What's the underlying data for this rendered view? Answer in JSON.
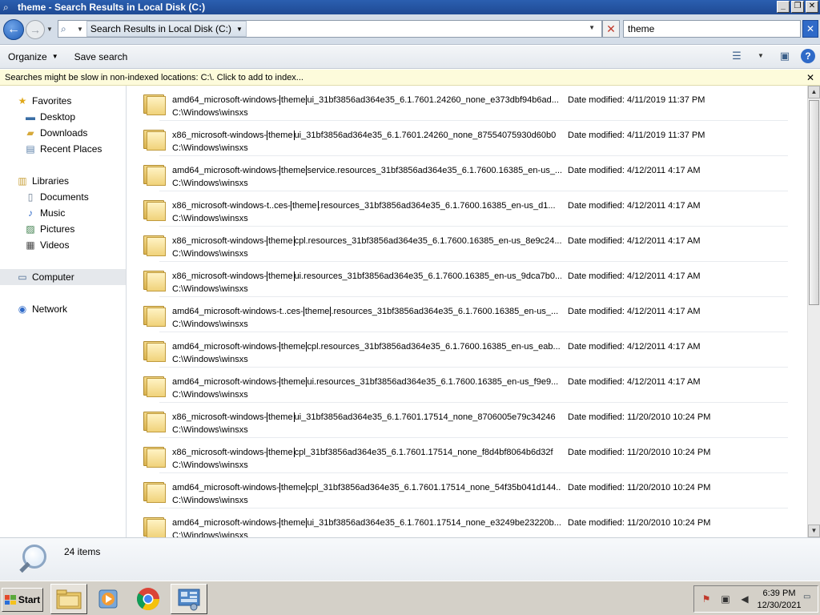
{
  "window": {
    "title": "theme - Search Results in Local Disk (C:)",
    "buttons": {
      "minimize": "_",
      "maximize": "❐",
      "close": "✕"
    }
  },
  "address": {
    "crumb": "Search Results in Local Disk (C:)",
    "search_value": "theme"
  },
  "toolbar": {
    "organize": "Organize",
    "save_search": "Save search"
  },
  "infobar": {
    "message": "Searches might be slow in non-indexed locations: C:\\. Click to add to index...",
    "close": "✕"
  },
  "nav": {
    "favorites": "Favorites",
    "desktop": "Desktop",
    "downloads": "Downloads",
    "recent_places": "Recent Places",
    "libraries": "Libraries",
    "documents": "Documents",
    "music": "Music",
    "pictures": "Pictures",
    "videos": "Videos",
    "computer": "Computer",
    "network": "Network"
  },
  "results": [
    {
      "pre": "amd64_microsoft-windows-",
      "hl": "theme",
      "post": "ui_31bf3856ad364e35_6.1.7601.24260_none_e373dbf94b6ad...",
      "path": "C:\\Windows\\winsxs",
      "date": "Date modified: 4/11/2019 11:37 PM"
    },
    {
      "pre": "x86_microsoft-windows-",
      "hl": "theme",
      "post": "ui_31bf3856ad364e35_6.1.7601.24260_none_87554075930d60b0",
      "path": "C:\\Windows\\winsxs",
      "date": "Date modified: 4/11/2019 11:37 PM"
    },
    {
      "pre": "amd64_microsoft-windows-",
      "hl": "theme",
      "post": "service.resources_31bf3856ad364e35_6.1.7600.16385_en-us_...",
      "path": "C:\\Windows\\winsxs",
      "date": "Date modified: 4/12/2011 4:17 AM"
    },
    {
      "pre": "x86_microsoft-windows-t..ces-",
      "hl": "theme",
      "post": ".resources_31bf3856ad364e35_6.1.7600.16385_en-us_d1...",
      "path": "C:\\Windows\\winsxs",
      "date": "Date modified: 4/12/2011 4:17 AM"
    },
    {
      "pre": "x86_microsoft-windows-",
      "hl": "theme",
      "post": "cpl.resources_31bf3856ad364e35_6.1.7600.16385_en-us_8e9c24...",
      "path": "C:\\Windows\\winsxs",
      "date": "Date modified: 4/12/2011 4:17 AM"
    },
    {
      "pre": "x86_microsoft-windows-",
      "hl": "theme",
      "post": "ui.resources_31bf3856ad364e35_6.1.7600.16385_en-us_9dca7b0...",
      "path": "C:\\Windows\\winsxs",
      "date": "Date modified: 4/12/2011 4:17 AM"
    },
    {
      "pre": "amd64_microsoft-windows-t..ces-",
      "hl": "theme",
      "post": ".resources_31bf3856ad364e35_6.1.7600.16385_en-us_...",
      "path": "C:\\Windows\\winsxs",
      "date": "Date modified: 4/12/2011 4:17 AM"
    },
    {
      "pre": "amd64_microsoft-windows-",
      "hl": "theme",
      "post": "cpl.resources_31bf3856ad364e35_6.1.7600.16385_en-us_eab...",
      "path": "C:\\Windows\\winsxs",
      "date": "Date modified: 4/12/2011 4:17 AM"
    },
    {
      "pre": "amd64_microsoft-windows-",
      "hl": "theme",
      "post": "ui.resources_31bf3856ad364e35_6.1.7600.16385_en-us_f9e9...",
      "path": "C:\\Windows\\winsxs",
      "date": "Date modified: 4/12/2011 4:17 AM"
    },
    {
      "pre": "x86_microsoft-windows-",
      "hl": "theme",
      "post": "ui_31bf3856ad364e35_6.1.7601.17514_none_8706005e79c34246",
      "path": "C:\\Windows\\winsxs",
      "date": "Date modified: 11/20/2010 10:24 PM"
    },
    {
      "pre": "x86_microsoft-windows-",
      "hl": "theme",
      "post": "cpl_31bf3856ad364e35_6.1.7601.17514_none_f8d4bf8064b6d32f",
      "path": "C:\\Windows\\winsxs",
      "date": "Date modified: 11/20/2010 10:24 PM"
    },
    {
      "pre": "amd64_microsoft-windows-",
      "hl": "theme",
      "post": "cpl_31bf3856ad364e35_6.1.7601.17514_none_54f35b041d144...",
      "path": "C:\\Windows\\winsxs",
      "date": "Date modified: 11/20/2010 10:24 PM"
    },
    {
      "pre": "amd64_microsoft-windows-",
      "hl": "theme",
      "post": "ui_31bf3856ad364e35_6.1.7601.17514_none_e3249be23220b...",
      "path": "C:\\Windows\\winsxs",
      "date": "Date modified: 11/20/2010 10:24 PM"
    }
  ],
  "details": {
    "count": "24 items"
  },
  "taskbar": {
    "start": "Start",
    "time": "6:39 PM",
    "date": "12/30/2021"
  }
}
